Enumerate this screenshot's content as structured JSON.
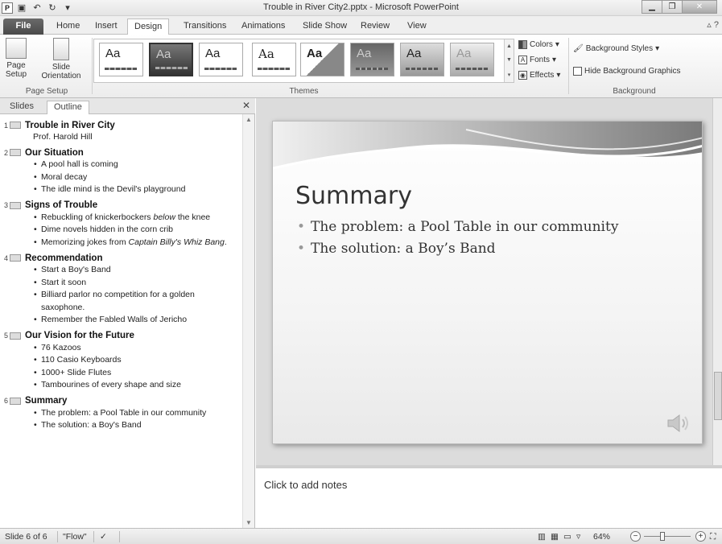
{
  "titlebar": {
    "title": "Trouble in River City2.pptx - Microsoft PowerPoint",
    "app_icon": "P",
    "quick_access": [
      "save-icon",
      "undo-icon",
      "redo-icon",
      "customize-icon"
    ]
  },
  "tabs": {
    "file": "File",
    "items": [
      "Home",
      "Insert",
      "Design",
      "Transitions",
      "Animations",
      "Slide Show",
      "Review",
      "View"
    ],
    "active": "Design"
  },
  "ribbon": {
    "page_setup": {
      "page_setup_label": "Page Setup",
      "page_setup_btn_line1": "Page",
      "page_setup_btn_line2": "Setup",
      "orientation_line1": "Slide",
      "orientation_line2": "Orientation"
    },
    "themes": {
      "group_label": "Themes",
      "sample_text": "Aa"
    },
    "theme_commands": {
      "colors": "Colors",
      "fonts": "Fonts",
      "effects": "Effects"
    },
    "background": {
      "group_label": "Background",
      "styles": "Background Styles",
      "hide_graphics": "Hide Background Graphics"
    }
  },
  "left_panel": {
    "tab_slides": "Slides",
    "tab_outline": "Outline",
    "slides": [
      {
        "num": "1",
        "title": "Trouble in River City",
        "subtitle": "Prof. Harold Hill",
        "bullets": []
      },
      {
        "num": "2",
        "title": "Our Situation",
        "bullets": [
          "A pool hall is coming",
          "Moral decay",
          "The idle mind is the Devil's playground"
        ]
      },
      {
        "num": "3",
        "title": "Signs of Trouble",
        "bullets": [
          "Rebuckling of knickerbockers below the knee",
          "Dime novels hidden in the corn crib",
          "Memorizing jokes from Captain Billy's Whiz Bang."
        ]
      },
      {
        "num": "4",
        "title": "Recommendation",
        "bullets": [
          "Start a Boy's Band",
          "Start it soon",
          "Billiard parlor no competition for a golden saxophone.",
          "Remember the Fabled Walls of Jericho"
        ]
      },
      {
        "num": "5",
        "title": "Our Vision for the Future",
        "bullets": [
          "76 Kazoos",
          "110 Casio Keyboards",
          "1000+ Slide Flutes",
          "Tambourines of every shape and size"
        ]
      },
      {
        "num": "6",
        "title": "Summary",
        "bullets": [
          "The problem:  a Pool Table in our community",
          "The solution:  a Boy's Band"
        ]
      }
    ]
  },
  "slide": {
    "heading": "Summary",
    "bullets": [
      "The problem: a Pool Table in our community",
      "The solution: a Boy’s Band"
    ]
  },
  "notes": {
    "placeholder": "Click to add notes"
  },
  "status": {
    "slide_indicator": "Slide 6 of 6",
    "theme_name": "\"Flow\"",
    "zoom": "64%"
  }
}
